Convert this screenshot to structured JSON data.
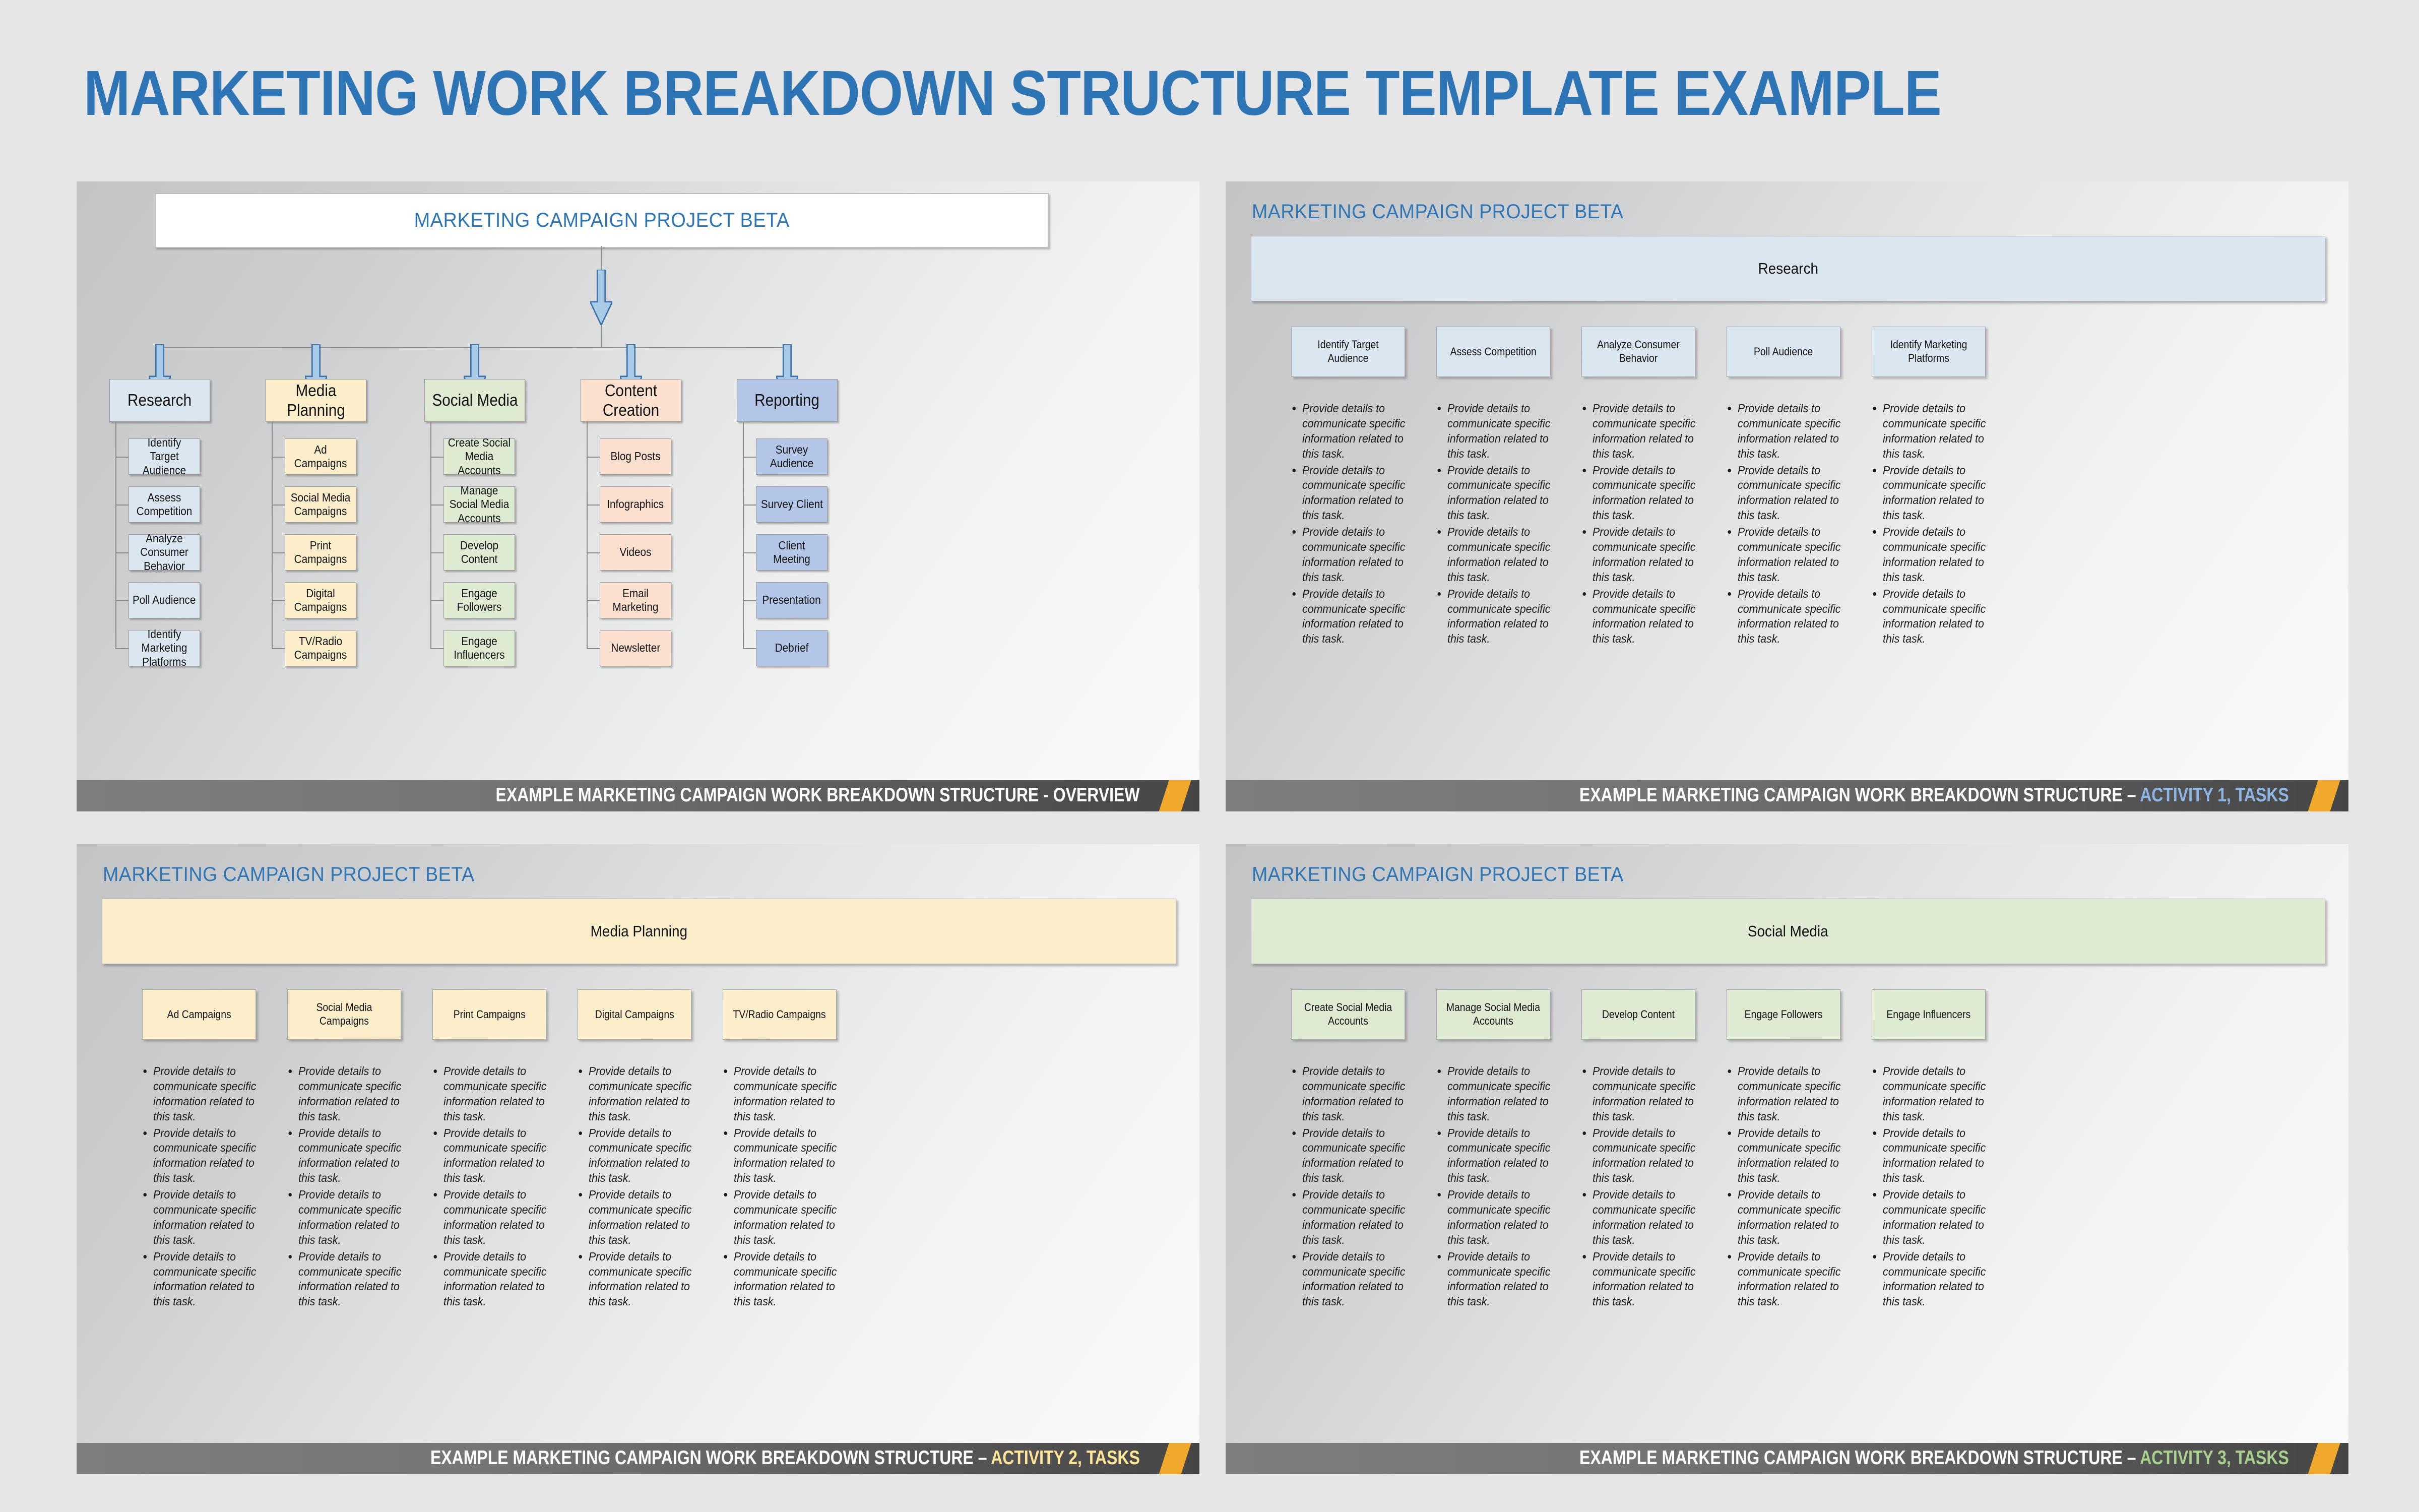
{
  "page": {
    "title": "MARKETING WORK BREAKDOWN STRUCTURE TEMPLATE EXAMPLE",
    "background_color": "#e6e6e6",
    "accent_blue": "#2E75B6",
    "accent_orange": "#F0A92C"
  },
  "bullet_text": "Provide details to communicate specific information related to this task.",
  "panels": {
    "overview": {
      "project_title": "MARKETING CAMPAIGN PROJECT BETA",
      "footer_prefix": "EXAMPLE MARKETING CAMPAIGN WORK BREAKDOWN STRUCTURE - OVERVIEW",
      "footer_accent": "",
      "branches": [
        {
          "name": "Research",
          "color": "#dce6f1",
          "tasks": [
            "Identify Target Audience",
            "Assess Competition",
            "Analyze Consumer Behavior",
            "Poll Audience",
            "Identify Marketing Platforms"
          ]
        },
        {
          "name": "Media Planning",
          "color": "#fdeecb",
          "tasks": [
            "Ad Campaigns",
            "Social Media Campaigns",
            "Print Campaigns",
            "Digital Campaigns",
            "TV/Radio Campaigns"
          ]
        },
        {
          "name": "Social Media",
          "color": "#dfead3",
          "tasks": [
            "Create Social Media Accounts",
            "Manage Social Media Accounts",
            "Develop Content",
            "Engage Followers",
            "Engage Influencers"
          ]
        },
        {
          "name": "Content Creation",
          "color": "#fbe0d0",
          "tasks": [
            "Blog Posts",
            "Infographics",
            "Videos",
            "Email Marketing",
            "Newsletter"
          ]
        },
        {
          "name": "Reporting",
          "color": "#b3c6e7",
          "tasks": [
            "Survey Audience",
            "Survey Client",
            "Client Meeting",
            "Presentation",
            "Debrief"
          ]
        }
      ]
    },
    "activity1": {
      "project_title": "MARKETING CAMPAIGN PROJECT BETA",
      "band_label": "Research",
      "band_color": "#dce6f1",
      "card_color": "#dce6f1",
      "footer_prefix": "EXAMPLE MARKETING CAMPAIGN WORK BREAKDOWN STRUCTURE – ",
      "footer_accent": "ACTIVITY 1, TASKS",
      "footer_accent_color": "#8EB4E3",
      "tasks": [
        "Identify Target Audience",
        "Assess Competition",
        "Analyze Consumer Behavior",
        "Poll Audience",
        "Identify Marketing Platforms"
      ],
      "bullets_per_task": 4
    },
    "activity2": {
      "project_title": "MARKETING CAMPAIGN PROJECT BETA",
      "band_label": "Media Planning",
      "band_color": "#fdeecb",
      "card_color": "#fdeecb",
      "footer_prefix": "EXAMPLE MARKETING CAMPAIGN WORK BREAKDOWN STRUCTURE – ",
      "footer_accent": "ACTIVITY 2, TASKS",
      "footer_accent_color": "#FFE699",
      "tasks": [
        "Ad Campaigns",
        "Social Media Campaigns",
        "Print Campaigns",
        "Digital Campaigns",
        "TV/Radio Campaigns"
      ],
      "bullets_per_task": 4
    },
    "activity3": {
      "project_title": "MARKETING CAMPAIGN PROJECT BETA",
      "band_label": "Social Media",
      "band_color": "#dfead3",
      "card_color": "#dfead3",
      "footer_prefix": "EXAMPLE MARKETING CAMPAIGN WORK BREAKDOWN STRUCTURE – ",
      "footer_accent": "ACTIVITY 3, TASKS",
      "footer_accent_color": "#A9D18E",
      "tasks": [
        "Create Social Media Accounts",
        "Manage Social Media Accounts",
        "Develop Content",
        "Engage Followers",
        "Engage Influencers"
      ],
      "bullets_per_task": 4
    }
  }
}
